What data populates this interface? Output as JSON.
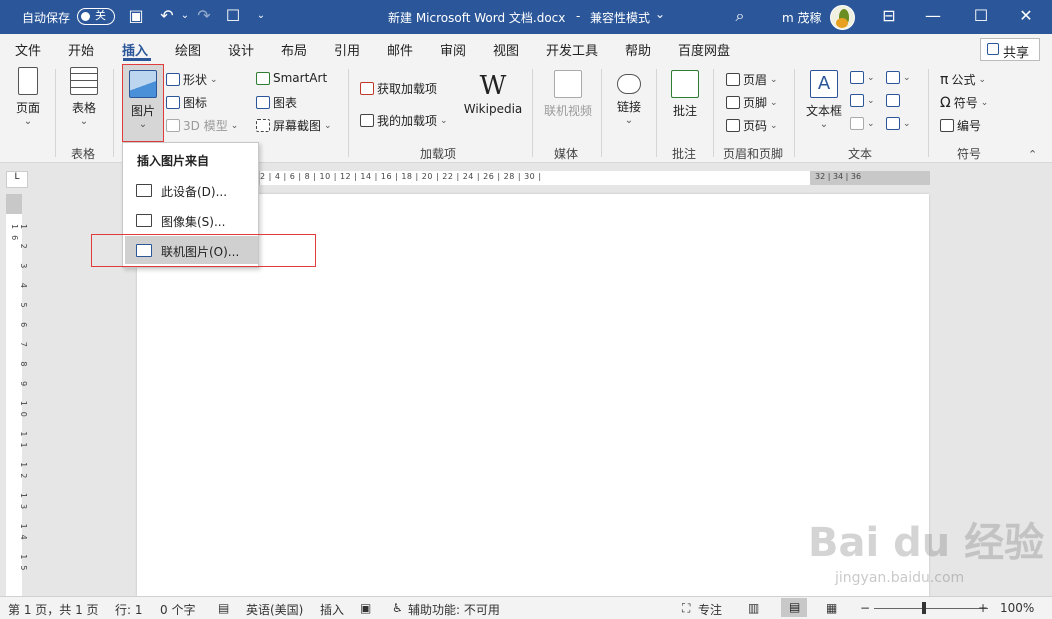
{
  "titlebar": {
    "autosave_label": "自动保存",
    "autosave_toggle": "关",
    "doc_title": "新建 Microsoft Word 文档.docx",
    "separator": "-",
    "mode": "兼容性模式",
    "mode_chevron": "⌄",
    "user_name": "m 茂稼",
    "bg_color": "#2b579a"
  },
  "tabs": [
    "文件",
    "开始",
    "插入",
    "绘图",
    "设计",
    "布局",
    "引用",
    "邮件",
    "审阅",
    "视图",
    "开发工具",
    "帮助",
    "百度网盘"
  ],
  "active_tab": "插入",
  "share_label": "共享",
  "ribbon": {
    "page_label": "页面",
    "table_label": "表格",
    "table_group": "表格",
    "picture_label": "图片",
    "shapes_label": "形状",
    "icons_label": "图标",
    "model3d_label": "3D 模型",
    "smartart_label": "SmartArt",
    "chart_label": "图表",
    "screenshot_label": "屏幕截图",
    "get_addins_label": "获取加载项",
    "my_addins_label": "我的加载项",
    "wikipedia_label": "Wikipedia",
    "addins_group": "加载项",
    "online_video_label": "联机视频",
    "media_group": "媒体",
    "link_label": "链接",
    "comment_label": "批注",
    "comment_group": "批注",
    "header_label": "页眉",
    "footer_label": "页脚",
    "pagenum_label": "页码",
    "headerfooter_group": "页眉和页脚",
    "textbox_label": "文本框",
    "text_group": "文本",
    "equation_label": "公式",
    "symbol_label": "符号",
    "numbering_label": "编号",
    "symbols_group": "符号"
  },
  "dropdown": {
    "header": "插入图片来自",
    "items": [
      "此设备(D)...",
      "图像集(S)...",
      "联机图片(O)..."
    ]
  },
  "ruler": {
    "ticks": "2 | 4 | 6 | 8 | 10 | 12 | 14 | 16 | 18 | 20 | 22 | 24 | 26 | 28 | 30 |",
    "ticks_end": "32 | 34 | 36",
    "vertical_ticks": "1 2 3 4 5 6 7 8 9 10 11 12 13 14 15 16",
    "corner": "L"
  },
  "statusbar": {
    "page": "第 1 页，共 1 页",
    "line": "行: 1",
    "words": "0 个字",
    "language": "英语(美国)",
    "insert_mode": "插入",
    "accessibility": "辅助功能: 不可用",
    "focus": "专注",
    "zoom": "100%",
    "zoom_minus": "−",
    "zoom_plus": "+"
  },
  "watermark": {
    "brand": "Bai du 经验",
    "url": "jingyan.baidu.com"
  }
}
